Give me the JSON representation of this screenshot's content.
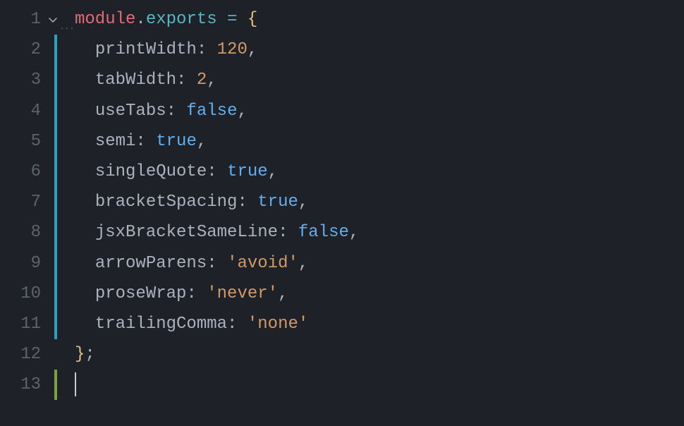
{
  "lines": [
    {
      "num": "1",
      "indicator": ""
    },
    {
      "num": "2",
      "indicator": "cyan"
    },
    {
      "num": "3",
      "indicator": "cyan"
    },
    {
      "num": "4",
      "indicator": "cyan"
    },
    {
      "num": "5",
      "indicator": "cyan"
    },
    {
      "num": "6",
      "indicator": "cyan"
    },
    {
      "num": "7",
      "indicator": "cyan"
    },
    {
      "num": "8",
      "indicator": "cyan"
    },
    {
      "num": "9",
      "indicator": "cyan"
    },
    {
      "num": "10",
      "indicator": "cyan"
    },
    {
      "num": "11",
      "indicator": "cyan"
    },
    {
      "num": "12",
      "indicator": ""
    },
    {
      "num": "13",
      "indicator": "green"
    }
  ],
  "code": {
    "l1_module": "module",
    "l1_dot": ".",
    "l1_exports": "exports",
    "l1_sp1": " ",
    "l1_assign": "=",
    "l1_sp2": " ",
    "l1_brace": "{",
    "l2_key": "printWidth",
    "l2_colon": ":",
    "l2_sp": " ",
    "l2_val": "120",
    "l2_comma": ",",
    "l3_key": "tabWidth",
    "l3_colon": ":",
    "l3_sp": " ",
    "l3_val": "2",
    "l3_comma": ",",
    "l4_key": "useTabs",
    "l4_colon": ":",
    "l4_sp": " ",
    "l4_val": "false",
    "l4_comma": ",",
    "l5_key": "semi",
    "l5_colon": ":",
    "l5_sp": " ",
    "l5_val": "true",
    "l5_comma": ",",
    "l6_key": "singleQuote",
    "l6_colon": ":",
    "l6_sp": " ",
    "l6_val": "true",
    "l6_comma": ",",
    "l7_key": "bracketSpacing",
    "l7_colon": ":",
    "l7_sp": " ",
    "l7_val": "true",
    "l7_comma": ",",
    "l8_key": "jsxBracketSameLine",
    "l8_colon": ":",
    "l8_sp": " ",
    "l8_val": "false",
    "l8_comma": ",",
    "l9_key": "arrowParens",
    "l9_colon": ":",
    "l9_sp": " ",
    "l9_val": "'avoid'",
    "l9_comma": ",",
    "l10_key": "proseWrap",
    "l10_colon": ":",
    "l10_sp": " ",
    "l10_val": "'never'",
    "l10_comma": ",",
    "l11_key": "trailingComma",
    "l11_colon": ":",
    "l11_sp": " ",
    "l11_val": "'none'",
    "l12_brace": "}",
    "l12_semi": ";",
    "indent2": "  ",
    "dots": "···"
  }
}
